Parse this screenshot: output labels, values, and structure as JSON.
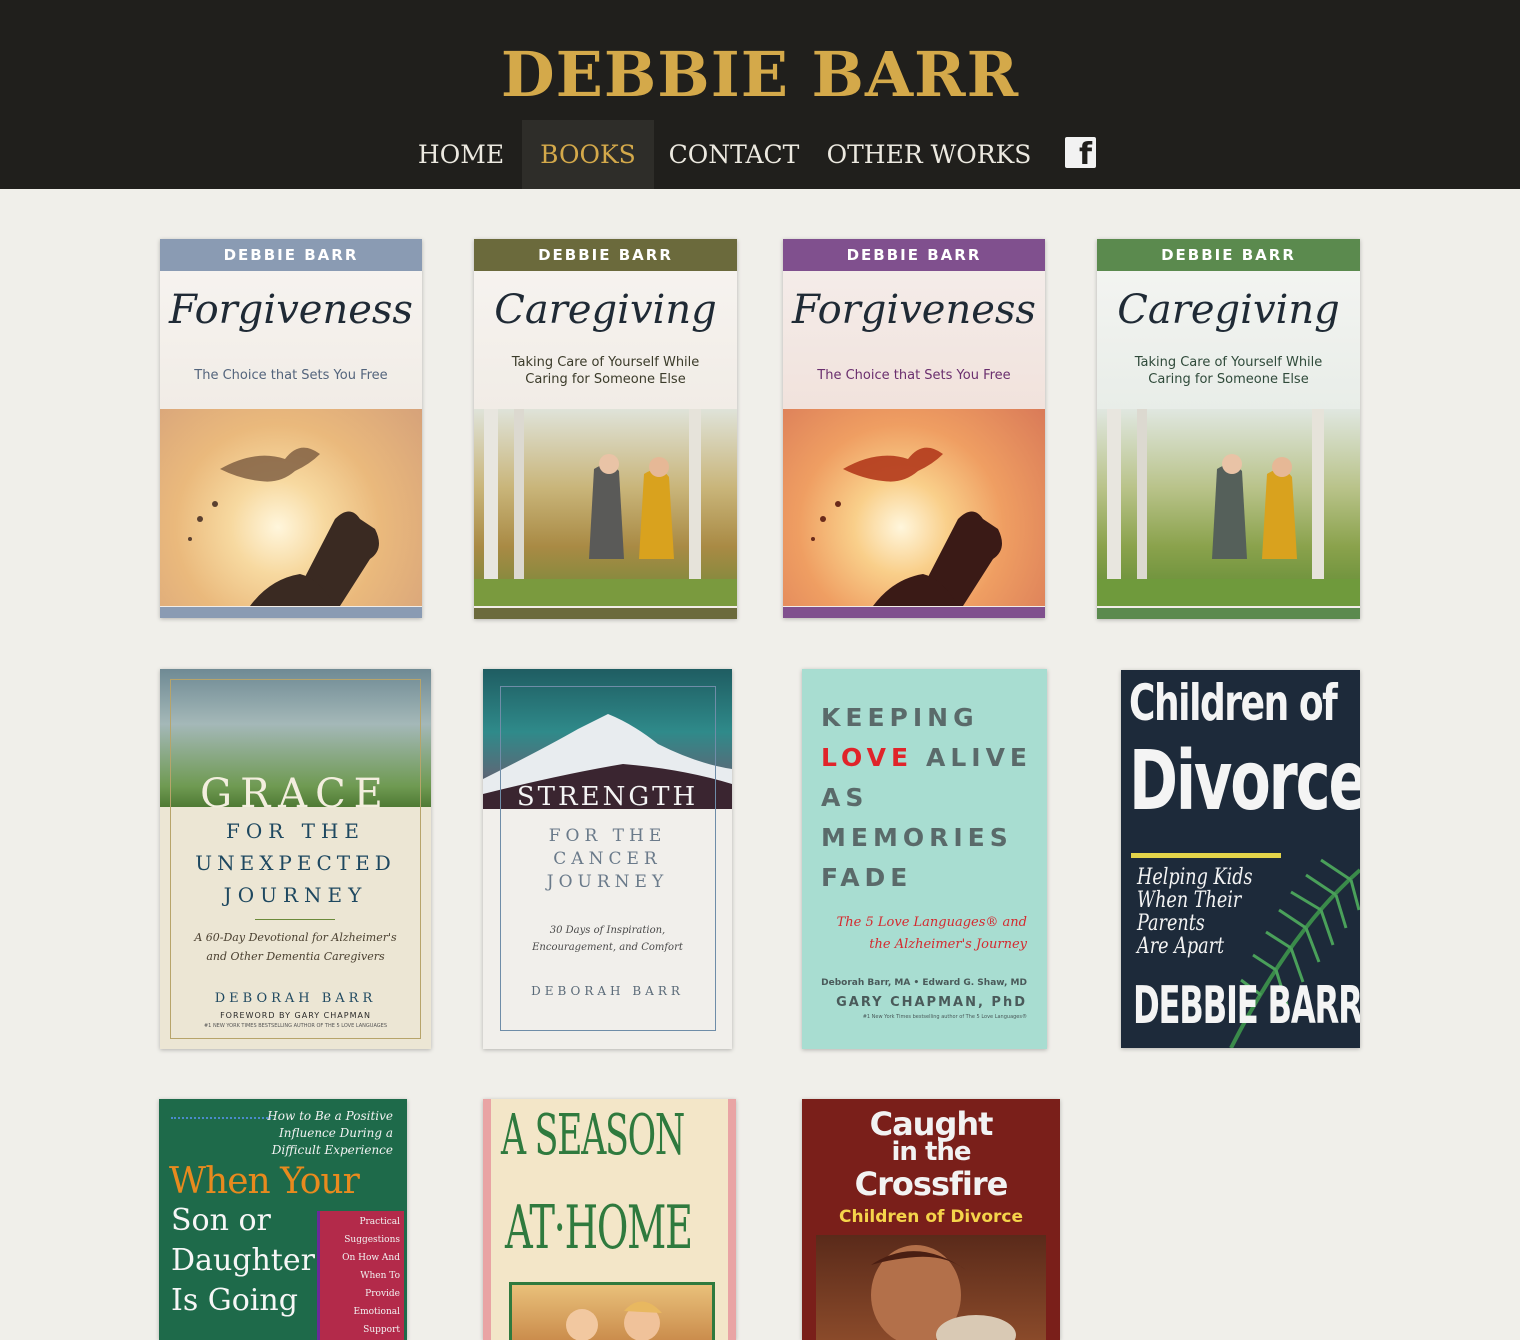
{
  "site": {
    "title": "DEBBIE BARR"
  },
  "nav": {
    "items": [
      {
        "label": "HOME"
      },
      {
        "label": "BOOKS"
      },
      {
        "label": "CONTACT"
      },
      {
        "label": "OTHER WORKS"
      }
    ],
    "active": "BOOKS",
    "facebook_icon": "facebook-icon"
  },
  "colors": {
    "header_bg": "#201f1c",
    "title_gold": "#d4a94a",
    "page_bg": "#f0efea"
  },
  "books": {
    "forgiveness_blue": {
      "author": "DEBBIE BARR",
      "title": "Forgiveness",
      "subtitle": "The Choice that Sets You Free",
      "accent": "#8a9bb3"
    },
    "caregiving_olive": {
      "author": "DEBBIE BARR",
      "title": "Caregiving",
      "subtitle_1": "Taking Care of Yourself While",
      "subtitle_2": "Caring for Someone Else",
      "accent": "#6b6a3c"
    },
    "forgiveness_purple": {
      "author": "DEBBIE BARR",
      "title": "Forgiveness",
      "subtitle": "The Choice that Sets You Free",
      "accent": "#80508e"
    },
    "caregiving_green": {
      "author": "DEBBIE BARR",
      "title": "Caregiving",
      "subtitle_1": "Taking Care of Yourself While",
      "subtitle_2": "Caring for Someone Else",
      "accent": "#5b8a4e"
    },
    "grace": {
      "title_1": "GRACE",
      "title_2": "FOR THE",
      "title_3": "UNEXPECTED",
      "title_4": "JOURNEY",
      "subtitle_1": "A 60-Day Devotional for Alzheimer's",
      "subtitle_2": "and Other Dementia Caregivers",
      "author": "DEBORAH BARR",
      "foreword": "FOREWORD BY GARY CHAPMAN",
      "tagline": "#1 NEW YORK TIMES BESTSELLING AUTHOR OF THE 5 LOVE LANGUAGES"
    },
    "strength": {
      "title_1": "STRENGTH",
      "title_2": "FOR THE",
      "title_3": "CANCER",
      "title_4": "JOURNEY",
      "subtitle_1": "30 Days of Inspiration,",
      "subtitle_2": "Encouragement, and Comfort",
      "author": "DEBORAH BARR"
    },
    "keeping_love": {
      "line_1": "KEEPING",
      "line_2a": "LOVE",
      "line_2b": "ALIVE",
      "line_3": "AS",
      "line_4": "MEMORIES",
      "line_5": "FADE",
      "subtitle_1": "The 5 Love Languages® and",
      "subtitle_2": "the Alzheimer's Journey",
      "authors": "Deborah Barr, MA • Edward G. Shaw, MD",
      "author_main": "GARY CHAPMAN, PhD",
      "tagline": "#1 New York Times bestselling author of The 5 Love Languages®"
    },
    "children_divorce": {
      "title_1": "Children of",
      "title_2": "Divorce",
      "subtitle_1": "Helping Kids",
      "subtitle_2": "When Their",
      "subtitle_3": "Parents",
      "subtitle_4": "Are Apart",
      "author": "DEBBIE BARR"
    },
    "son_daughter": {
      "top_1": "How to Be a Positive",
      "top_2": "Influence During a",
      "top_3": "Difficult Experience",
      "title_1": "When Your",
      "title_2": "Son or",
      "title_3": "Daughter",
      "title_4": "Is Going",
      "side": [
        "Practical",
        "Suggestions",
        "On How And",
        "When To",
        "Provide",
        "Emotional",
        "Support"
      ]
    },
    "season_home": {
      "title_1": "A SEASON",
      "title_2": "AT·HOME"
    },
    "caught_crossfire": {
      "title_1": "Caught",
      "title_2": "in the",
      "title_3": "Crossfire",
      "subtitle": "Children of Divorce"
    }
  }
}
